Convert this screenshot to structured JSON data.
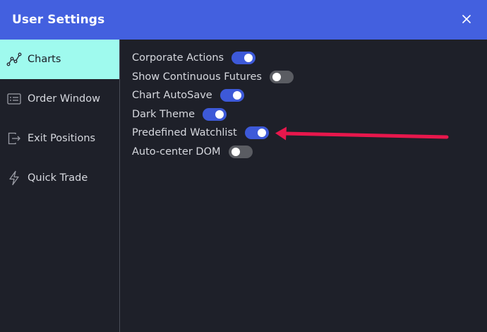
{
  "dialog": {
    "title": "User Settings"
  },
  "sidebar": {
    "items": [
      {
        "label": "Charts",
        "icon": "chart-line-icon",
        "active": true
      },
      {
        "label": "Order Window",
        "icon": "order-window-icon",
        "active": false
      },
      {
        "label": "Exit Positions",
        "icon": "exit-icon",
        "active": false
      },
      {
        "label": "Quick Trade",
        "icon": "lightning-icon",
        "active": false
      }
    ]
  },
  "options": [
    {
      "label": "Corporate Actions",
      "enabled": true
    },
    {
      "label": "Show Continuous Futures",
      "enabled": false
    },
    {
      "label": "Chart AutoSave",
      "enabled": true
    },
    {
      "label": "Dark Theme",
      "enabled": true
    },
    {
      "label": "Predefined Watchlist",
      "enabled": true
    },
    {
      "label": "Auto-center DOM",
      "enabled": false
    }
  ],
  "colors": {
    "header": "#4360df",
    "active_nav": "#9ffaee",
    "toggle_on": "#3d59d8",
    "toggle_off": "#5a5c62",
    "annotation_arrow": "#e8174c"
  }
}
